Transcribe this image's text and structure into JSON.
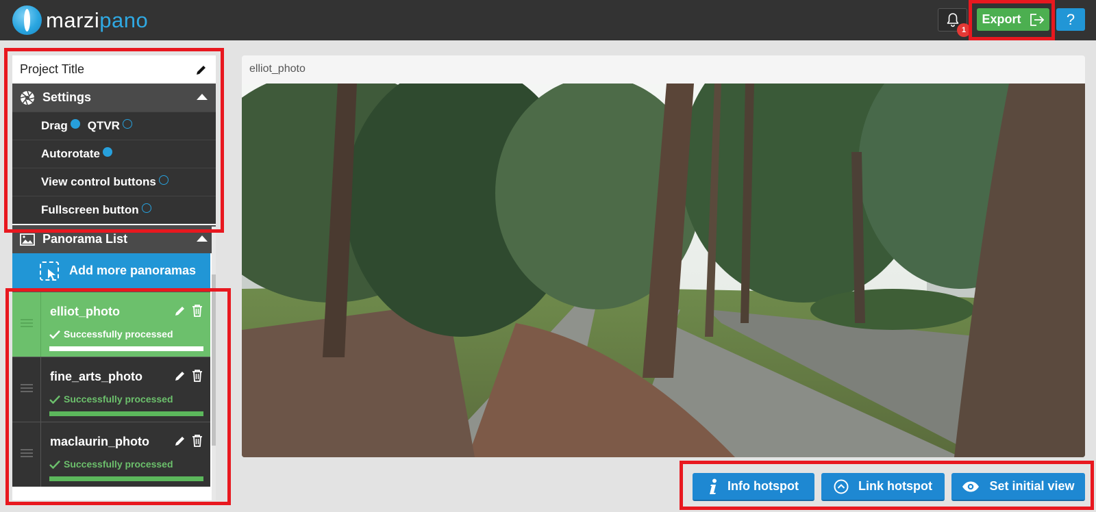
{
  "app": {
    "logo_part1": "marzi",
    "logo_part2": "pano"
  },
  "header": {
    "notification_count": "1",
    "export_label": "Export",
    "help_label": "?"
  },
  "sidebar": {
    "project_title": "Project Title",
    "settings_label": "Settings",
    "options": [
      {
        "label": "Drag",
        "selected": true
      },
      {
        "label": "QTVR",
        "selected": false
      },
      {
        "label": "Autorotate",
        "selected": true
      },
      {
        "label": "View control buttons",
        "selected": false
      },
      {
        "label": "Fullscreen button",
        "selected": false
      }
    ],
    "panorama_list_label": "Panorama List",
    "add_label": "Add more panoramas",
    "panoramas": [
      {
        "name": "elliot_photo",
        "status": "Successfully processed",
        "active": true
      },
      {
        "name": "fine_arts_photo",
        "status": "Successfully processed",
        "active": false
      },
      {
        "name": "maclaurin_photo",
        "status": "Successfully processed",
        "active": false
      }
    ]
  },
  "viewer": {
    "title": "elliot_photo"
  },
  "actions": {
    "info_hotspot": "Info hotspot",
    "link_hotspot": "Link hotspot",
    "set_initial_view": "Set initial view"
  },
  "colors": {
    "topbar": "#333333",
    "accent_blue": "#2196d6",
    "success_green": "#4caf50",
    "highlight_red": "#e8181f"
  }
}
